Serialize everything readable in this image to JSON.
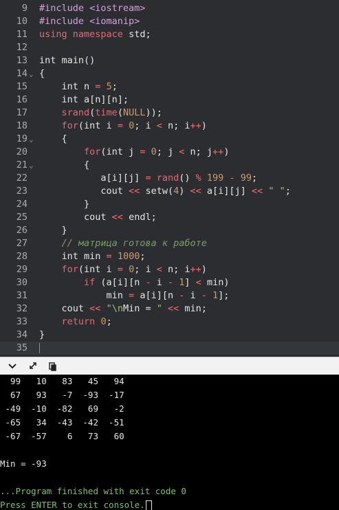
{
  "editor": {
    "lines": [
      {
        "n": "9",
        "fold": "",
        "tokens": [
          {
            "c": "preproc",
            "t": "#include <iostream>"
          }
        ]
      },
      {
        "n": "10",
        "fold": "",
        "tokens": [
          {
            "c": "preproc",
            "t": "#include <iomanip>"
          }
        ]
      },
      {
        "n": "11",
        "fold": "",
        "tokens": [
          {
            "c": "kw",
            "t": "using"
          },
          {
            "c": "text",
            "t": " "
          },
          {
            "c": "kw",
            "t": "namespace"
          },
          {
            "c": "text",
            "t": " std;"
          }
        ]
      },
      {
        "n": "12",
        "fold": "",
        "tokens": []
      },
      {
        "n": "13",
        "fold": "",
        "tokens": [
          {
            "c": "type",
            "t": "int"
          },
          {
            "c": "text",
            "t": " main()"
          }
        ]
      },
      {
        "n": "14",
        "fold": "v",
        "tokens": [
          {
            "c": "text",
            "t": "{"
          }
        ]
      },
      {
        "n": "15",
        "fold": "",
        "tokens": [
          {
            "c": "text",
            "t": "    int n "
          },
          {
            "c": "op",
            "t": "="
          },
          {
            "c": "text",
            "t": " "
          },
          {
            "c": "num",
            "t": "5"
          },
          {
            "c": "text",
            "t": ";"
          }
        ]
      },
      {
        "n": "16",
        "fold": "",
        "tokens": [
          {
            "c": "text",
            "t": "    int a[n][n];"
          }
        ]
      },
      {
        "n": "17",
        "fold": "",
        "tokens": [
          {
            "c": "text",
            "t": "    "
          },
          {
            "c": "fn",
            "t": "srand"
          },
          {
            "c": "text",
            "t": "("
          },
          {
            "c": "fn",
            "t": "time"
          },
          {
            "c": "text",
            "t": "("
          },
          {
            "c": "num",
            "t": "NULL"
          },
          {
            "c": "text",
            "t": "));"
          }
        ]
      },
      {
        "n": "18",
        "fold": "",
        "tokens": [
          {
            "c": "text",
            "t": "    "
          },
          {
            "c": "kw",
            "t": "for"
          },
          {
            "c": "text",
            "t": "(int i "
          },
          {
            "c": "op",
            "t": "="
          },
          {
            "c": "text",
            "t": " "
          },
          {
            "c": "num",
            "t": "0"
          },
          {
            "c": "text",
            "t": "; i "
          },
          {
            "c": "op",
            "t": "<"
          },
          {
            "c": "text",
            "t": " n; i"
          },
          {
            "c": "op",
            "t": "++"
          },
          {
            "c": "text",
            "t": ")"
          }
        ]
      },
      {
        "n": "19",
        "fold": "v",
        "tokens": [
          {
            "c": "text",
            "t": "    {"
          }
        ]
      },
      {
        "n": "20",
        "fold": "",
        "tokens": [
          {
            "c": "text",
            "t": "        "
          },
          {
            "c": "kw",
            "t": "for"
          },
          {
            "c": "text",
            "t": "(int j "
          },
          {
            "c": "op",
            "t": "="
          },
          {
            "c": "text",
            "t": " "
          },
          {
            "c": "num",
            "t": "0"
          },
          {
            "c": "text",
            "t": "; j "
          },
          {
            "c": "op",
            "t": "<"
          },
          {
            "c": "text",
            "t": " n; j"
          },
          {
            "c": "op",
            "t": "++"
          },
          {
            "c": "text",
            "t": ")"
          }
        ]
      },
      {
        "n": "21",
        "fold": "v",
        "tokens": [
          {
            "c": "text",
            "t": "        {"
          }
        ]
      },
      {
        "n": "22",
        "fold": "",
        "tokens": [
          {
            "c": "text",
            "t": "           a[i][j] "
          },
          {
            "c": "op",
            "t": "="
          },
          {
            "c": "text",
            "t": " "
          },
          {
            "c": "fn",
            "t": "rand"
          },
          {
            "c": "text",
            "t": "() "
          },
          {
            "c": "op",
            "t": "%"
          },
          {
            "c": "text",
            "t": " "
          },
          {
            "c": "num",
            "t": "199"
          },
          {
            "c": "text",
            "t": " "
          },
          {
            "c": "op",
            "t": "-"
          },
          {
            "c": "text",
            "t": " "
          },
          {
            "c": "num",
            "t": "99"
          },
          {
            "c": "text",
            "t": ";"
          }
        ]
      },
      {
        "n": "23",
        "fold": "",
        "tokens": [
          {
            "c": "text",
            "t": "           cout "
          },
          {
            "c": "op",
            "t": "<<"
          },
          {
            "c": "text",
            "t": " setw("
          },
          {
            "c": "num",
            "t": "4"
          },
          {
            "c": "text",
            "t": ") "
          },
          {
            "c": "op",
            "t": "<<"
          },
          {
            "c": "text",
            "t": " a[i][j] "
          },
          {
            "c": "op",
            "t": "<<"
          },
          {
            "c": "text",
            "t": " "
          },
          {
            "c": "str",
            "t": "\" \""
          },
          {
            "c": "text",
            "t": ";"
          }
        ]
      },
      {
        "n": "24",
        "fold": "",
        "tokens": [
          {
            "c": "text",
            "t": "        }"
          }
        ]
      },
      {
        "n": "25",
        "fold": "",
        "tokens": [
          {
            "c": "text",
            "t": "        cout "
          },
          {
            "c": "op",
            "t": "<<"
          },
          {
            "c": "text",
            "t": " endl;"
          }
        ]
      },
      {
        "n": "26",
        "fold": "",
        "tokens": [
          {
            "c": "text",
            "t": "    }"
          }
        ]
      },
      {
        "n": "27",
        "fold": "",
        "tokens": [
          {
            "c": "text",
            "t": "    "
          },
          {
            "c": "cmt",
            "t": "// матрица готова к работе"
          }
        ]
      },
      {
        "n": "28",
        "fold": "",
        "tokens": [
          {
            "c": "text",
            "t": "    int min "
          },
          {
            "c": "op",
            "t": "="
          },
          {
            "c": "text",
            "t": " "
          },
          {
            "c": "num",
            "t": "1000"
          },
          {
            "c": "text",
            "t": ";"
          }
        ]
      },
      {
        "n": "29",
        "fold": "",
        "tokens": [
          {
            "c": "text",
            "t": "    "
          },
          {
            "c": "kw",
            "t": "for"
          },
          {
            "c": "text",
            "t": "(int i "
          },
          {
            "c": "op",
            "t": "="
          },
          {
            "c": "text",
            "t": " "
          },
          {
            "c": "num",
            "t": "0"
          },
          {
            "c": "text",
            "t": "; i "
          },
          {
            "c": "op",
            "t": "<"
          },
          {
            "c": "text",
            "t": " n; i"
          },
          {
            "c": "op",
            "t": "++"
          },
          {
            "c": "text",
            "t": ")"
          }
        ]
      },
      {
        "n": "30",
        "fold": "",
        "tokens": [
          {
            "c": "text",
            "t": "        "
          },
          {
            "c": "kw",
            "t": "if"
          },
          {
            "c": "text",
            "t": " (a[i][n "
          },
          {
            "c": "op",
            "t": "-"
          },
          {
            "c": "text",
            "t": " i "
          },
          {
            "c": "op",
            "t": "-"
          },
          {
            "c": "text",
            "t": " "
          },
          {
            "c": "num",
            "t": "1"
          },
          {
            "c": "text",
            "t": "] "
          },
          {
            "c": "op",
            "t": "<"
          },
          {
            "c": "text",
            "t": " min)"
          }
        ]
      },
      {
        "n": "31",
        "fold": "",
        "tokens": [
          {
            "c": "text",
            "t": "            min "
          },
          {
            "c": "op",
            "t": "="
          },
          {
            "c": "text",
            "t": " a[i][n "
          },
          {
            "c": "op",
            "t": "-"
          },
          {
            "c": "text",
            "t": " i "
          },
          {
            "c": "op",
            "t": "-"
          },
          {
            "c": "text",
            "t": " "
          },
          {
            "c": "num",
            "t": "1"
          },
          {
            "c": "text",
            "t": "];"
          }
        ]
      },
      {
        "n": "32",
        "fold": "",
        "tokens": [
          {
            "c": "text",
            "t": "    cout "
          },
          {
            "c": "op",
            "t": "<<"
          },
          {
            "c": "text",
            "t": " "
          },
          {
            "c": "str",
            "t": "\"\\n"
          },
          {
            "c": "text",
            "t": "Min = "
          },
          {
            "c": "str",
            "t": "\""
          },
          {
            "c": "text",
            "t": " "
          },
          {
            "c": "op",
            "t": "<<"
          },
          {
            "c": "text",
            "t": " min;"
          }
        ]
      },
      {
        "n": "33",
        "fold": "",
        "tokens": [
          {
            "c": "text",
            "t": "    "
          },
          {
            "c": "kw",
            "t": "return"
          },
          {
            "c": "text",
            "t": " "
          },
          {
            "c": "num",
            "t": "0"
          },
          {
            "c": "text",
            "t": ";"
          }
        ]
      },
      {
        "n": "34",
        "fold": "",
        "tokens": [
          {
            "c": "text",
            "t": "}"
          }
        ]
      },
      {
        "n": "35",
        "fold": "",
        "tokens": [],
        "active": true
      }
    ]
  },
  "toolbar": {
    "icons": [
      "chevron-down-icon",
      "expand-icon",
      "copy-icon"
    ]
  },
  "console": {
    "lines": [
      {
        "text": "  99   10   83   45   94",
        "style": "normal"
      },
      {
        "text": "  67   93   -7  -93  -17",
        "style": "normal"
      },
      {
        "text": " -49  -10  -82   69   -2",
        "style": "normal"
      },
      {
        "text": " -65   34  -43  -42  -51",
        "style": "normal"
      },
      {
        "text": " -67  -57    6   73   60",
        "style": "normal"
      },
      {
        "text": "",
        "style": "normal"
      },
      {
        "text": "Min = -93",
        "style": "normal"
      },
      {
        "text": "",
        "style": "normal"
      },
      {
        "text": "...Program finished with exit code 0",
        "style": "green"
      },
      {
        "text": "Press ENTER to exit console.",
        "style": "green",
        "caret": true
      }
    ]
  }
}
